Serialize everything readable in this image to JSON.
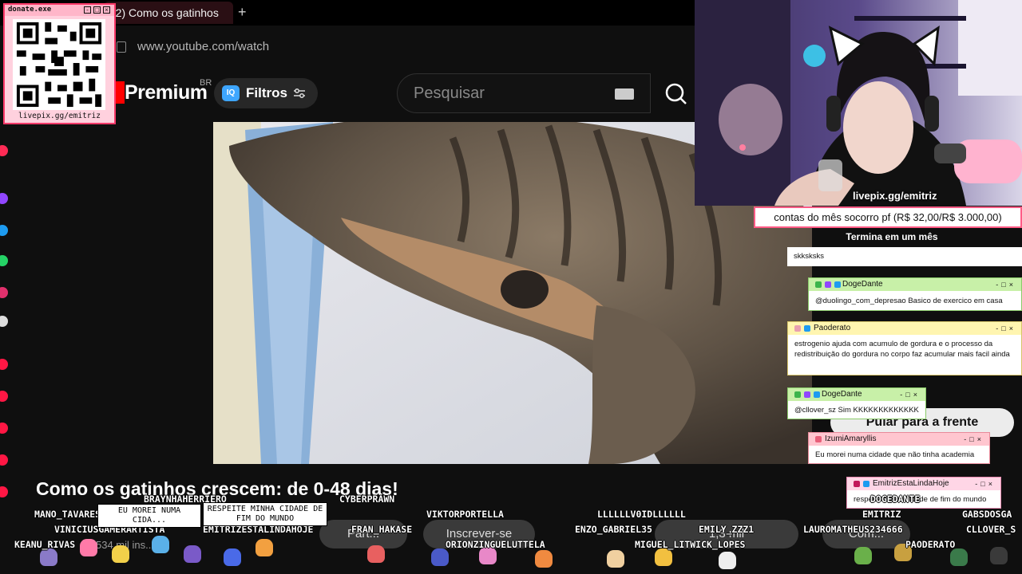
{
  "browser": {
    "tab_title": "(2) Como os gatinhos",
    "new_tab_symbol": "+",
    "url": "www.youtube.com/watch"
  },
  "youtube": {
    "logo_text": "Premium",
    "region_badge": "BR",
    "filter_badge": "IQ",
    "filter_label": "Filtros",
    "search_placeholder": "Pesquisar",
    "video_title": "Como os gatinhos crescem: de 0-48 dias!",
    "subscribers": "534 mil ins...",
    "participate_label": "Part...",
    "subscribe_label": "Inscrever-se",
    "likes": "1,3 mil",
    "share_label": "Com..."
  },
  "stream": {
    "qr": {
      "title": "donate.exe",
      "caption": "livepix.gg/emitriz"
    },
    "cam_handle": "livepix.gg/emitriz",
    "goal": {
      "text": "contas do mês socorro pf (R$ 32,00/R$ 3.000,00)",
      "subtitle": "Termina em um mês"
    },
    "skip_label": "Pular para a frente",
    "chat": [
      {
        "user": "",
        "message": "skksksks",
        "color": "#ffffff"
      },
      {
        "user": "DogeDante",
        "message": "@duolingo_com_depresao Basico de exercico em casa",
        "color": "#c8f0a8"
      },
      {
        "user": "Paoderato",
        "message": "estrogenio ajuda com acumulo de gordura e o processo da redistribuição do gordura no corpo faz acumular mais facil ainda",
        "color": "#fff5b0"
      },
      {
        "user": "DogeDante",
        "message": "@cllover_sz Sim KKKKKKKKKKKKK",
        "color": "#c8f0a8"
      },
      {
        "user": "IzumiAmaryllis",
        "message": "Eu morei numa cidade que não tinha academia",
        "color": "#ffc6cf"
      },
      {
        "user": "EmitrizEstaLindaHoje",
        "message": "respeite minha cidade de fim do mundo",
        "color": "#ffd6e6"
      }
    ],
    "overlay_names": [
      "MANO_TAVARES",
      "BRAYNHAHERRIERO",
      "CYBERPRAWN",
      "VIKTORPORTELLA",
      "LLLLLLV0IDLLLLLL",
      "DOGEDANTE",
      "EMITRIZ",
      "GABSDOSGA",
      "VINICIUSGAMERARTISTA",
      "EMITRIZESTALINDAHOJE",
      "FRAN_HAKASE",
      "ENZO_GABRIEL35",
      "EMILY_ZZZ1",
      "LAUROMATHEUS234666",
      "CLLOVER_S",
      "KEANU_RIVAS",
      "ORIONZINGUELUTTELA",
      "MIGUEL_LITWICK_LOPES",
      "PAODERATO"
    ],
    "overlay_speech": [
      "EU MOREI NUMA CIDA...",
      "RESPEITE MINHA CIDADE DE FIM DO MUNDO"
    ]
  }
}
